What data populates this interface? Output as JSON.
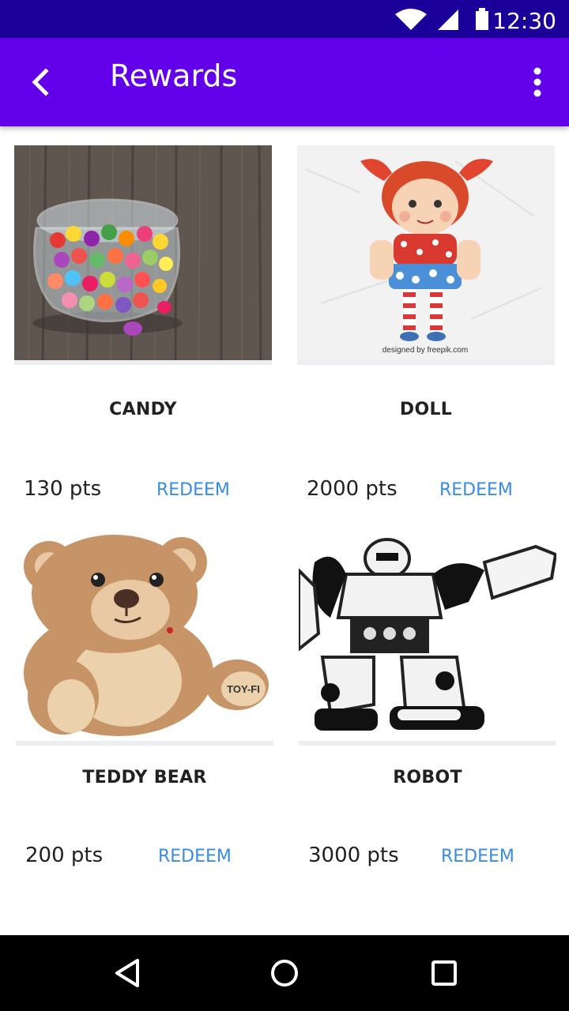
{
  "status_bar": {
    "time": "12:30"
  },
  "app_bar": {
    "title": "Rewards"
  },
  "rewards": [
    {
      "name": "CANDY",
      "points": "130 pts",
      "action": "REDEEM"
    },
    {
      "name": "DOLL",
      "points": "2000 pts",
      "action": "REDEEM",
      "image_credit": "designed by freepik.com"
    },
    {
      "name": "TEDDY BEAR",
      "points": "200 pts",
      "action": "REDEEM",
      "tag_text": "TOY-FI"
    },
    {
      "name": "ROBOT",
      "points": "3000 pts",
      "action": "REDEEM"
    }
  ],
  "icons": [
    "wifi-icon",
    "signal-icon",
    "battery-icon",
    "back-arrow-icon",
    "more-vert-icon",
    "nav-back-icon",
    "nav-home-icon",
    "nav-recents-icon"
  ],
  "colors": {
    "status_bar": "#1a0099",
    "app_bar": "#6200ea",
    "accent": "#3a8ce0"
  }
}
